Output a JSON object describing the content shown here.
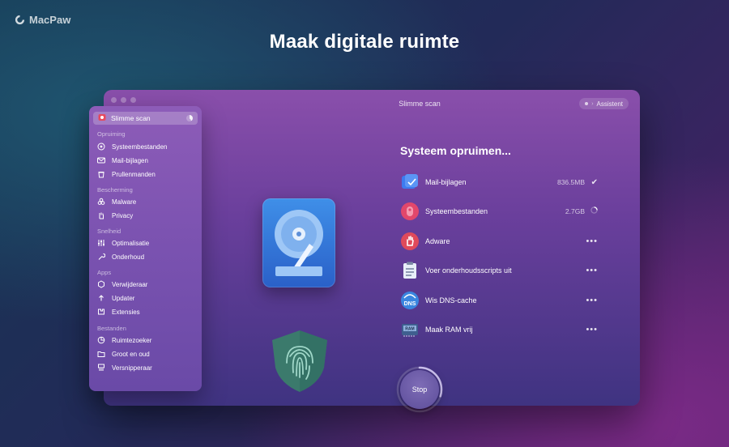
{
  "brand": {
    "name": "MacPaw"
  },
  "headline": "Maak digitale ruimte",
  "window": {
    "title": "Slimme scan",
    "assistant_label": "Assistent"
  },
  "sidebar": {
    "active": {
      "label": "Slimme scan",
      "icon": "smart-scan-icon"
    },
    "sections": [
      {
        "title": "Opruiming",
        "items": [
          {
            "label": "Systeembestanden",
            "icon": "system-junk-icon"
          },
          {
            "label": "Mail-bijlagen",
            "icon": "mail-icon"
          },
          {
            "label": "Prullenmanden",
            "icon": "trash-icon"
          }
        ]
      },
      {
        "title": "Bescherming",
        "items": [
          {
            "label": "Malware",
            "icon": "biohazard-icon"
          },
          {
            "label": "Privacy",
            "icon": "hand-icon"
          }
        ]
      },
      {
        "title": "Snelheid",
        "items": [
          {
            "label": "Optimalisatie",
            "icon": "sliders-icon"
          },
          {
            "label": "Onderhoud",
            "icon": "wrench-icon"
          }
        ]
      },
      {
        "title": "Apps",
        "items": [
          {
            "label": "Verwijderaar",
            "icon": "uninstaller-icon"
          },
          {
            "label": "Updater",
            "icon": "update-arrow-icon"
          },
          {
            "label": "Extensies",
            "icon": "extensions-icon"
          }
        ]
      },
      {
        "title": "Bestanden",
        "items": [
          {
            "label": "Ruimtezoeker",
            "icon": "space-lens-icon"
          },
          {
            "label": "Groot en oud",
            "icon": "folder-icon"
          },
          {
            "label": "Versnipperaar",
            "icon": "shredder-icon"
          }
        ]
      }
    ]
  },
  "main": {
    "title": "Systeem opruimen...",
    "tasks": [
      {
        "label": "Mail-bijlagen",
        "size": "836.5MB",
        "state": "done",
        "icon": "mail-attachments-icon",
        "color": "#3d7bf0"
      },
      {
        "label": "Systeembestanden",
        "size": "2.7GB",
        "state": "running",
        "icon": "system-junk-icon",
        "color": "#e2476b"
      },
      {
        "label": "Adware",
        "size": "",
        "state": "pending",
        "icon": "adware-hand-icon",
        "color": "#e04a5b"
      },
      {
        "label": "Voer onderhoudsscripts uit",
        "size": "",
        "state": "pending",
        "icon": "clipboard-icon",
        "color": "#e8eef8"
      },
      {
        "label": "Wis DNS-cache",
        "size": "",
        "state": "pending",
        "icon": "dns-icon",
        "color": "#3a86e0"
      },
      {
        "label": "Maak RAM vrij",
        "size": "",
        "state": "pending",
        "icon": "ram-chip-icon",
        "color": "#3f5f8f"
      }
    ],
    "done_symbol": "✔",
    "more_symbol": "•••",
    "stop_label": "Stop",
    "stop_progress": 0.3
  }
}
